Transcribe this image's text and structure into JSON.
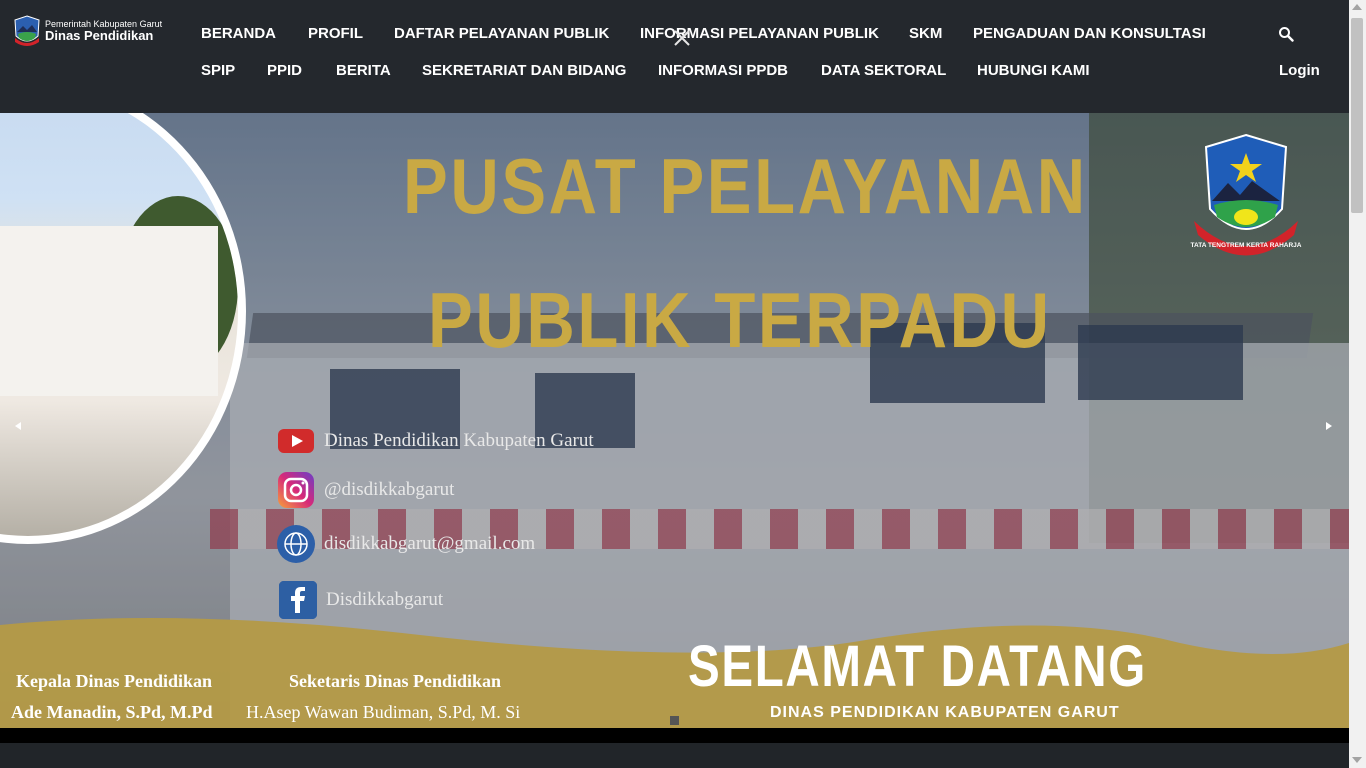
{
  "header": {
    "logo_line1": "Pemerintah Kabupaten Garut",
    "logo_line2": "Dinas Pendidikan",
    "nav_row1": [
      "BERANDA",
      "PROFIL",
      "DAFTAR PELAYANAN PUBLIK",
      "INFORMASI PELAYANAN PUBLIK",
      "SKM",
      "PENGADUAN DAN KONSULTASI"
    ],
    "nav_row2": [
      "SPIP",
      "PPID",
      "BERITA",
      "SEKRETARIAT DAN BIDANG",
      "INFORMASI PPDB",
      "DATA SEKTORAL",
      "HUBUNGI KAMI"
    ],
    "login": "Login",
    "search_icon": "search-icon",
    "close_icon": "close-icon"
  },
  "banner": {
    "title_line1": "PUSAT PELAYANAN",
    "title_line2": "PUBLIK TERPADU",
    "crest_motto": "TATA TENGTREM KERTA RAHARJA",
    "social": [
      {
        "icon": "youtube-icon",
        "text": "Dinas Pendidikan Kabupaten Garut"
      },
      {
        "icon": "instagram-icon",
        "text": "@disdikkabgarut"
      },
      {
        "icon": "globe-icon",
        "text": "disdikkabgarut@gmail.com"
      },
      {
        "icon": "facebook-icon",
        "text": "Disdikkabgarut"
      }
    ],
    "welcome": "SELAMAT DATANG",
    "welcome_sub": "DINAS PENDIDIKAN KABUPATEN GARUT",
    "officials": [
      {
        "role": "Kepala Dinas Pendidikan",
        "name": "Ade Manadin, S.Pd, M.Pd"
      },
      {
        "role": "Seketaris Dinas Pendidikan",
        "name": "H.Asep Wawan Budiman, S.Pd, M. Si"
      }
    ]
  },
  "colors": {
    "header_bg": "#24282d",
    "title_gold": "#c9a944",
    "wave_gold": "#b49a46"
  }
}
